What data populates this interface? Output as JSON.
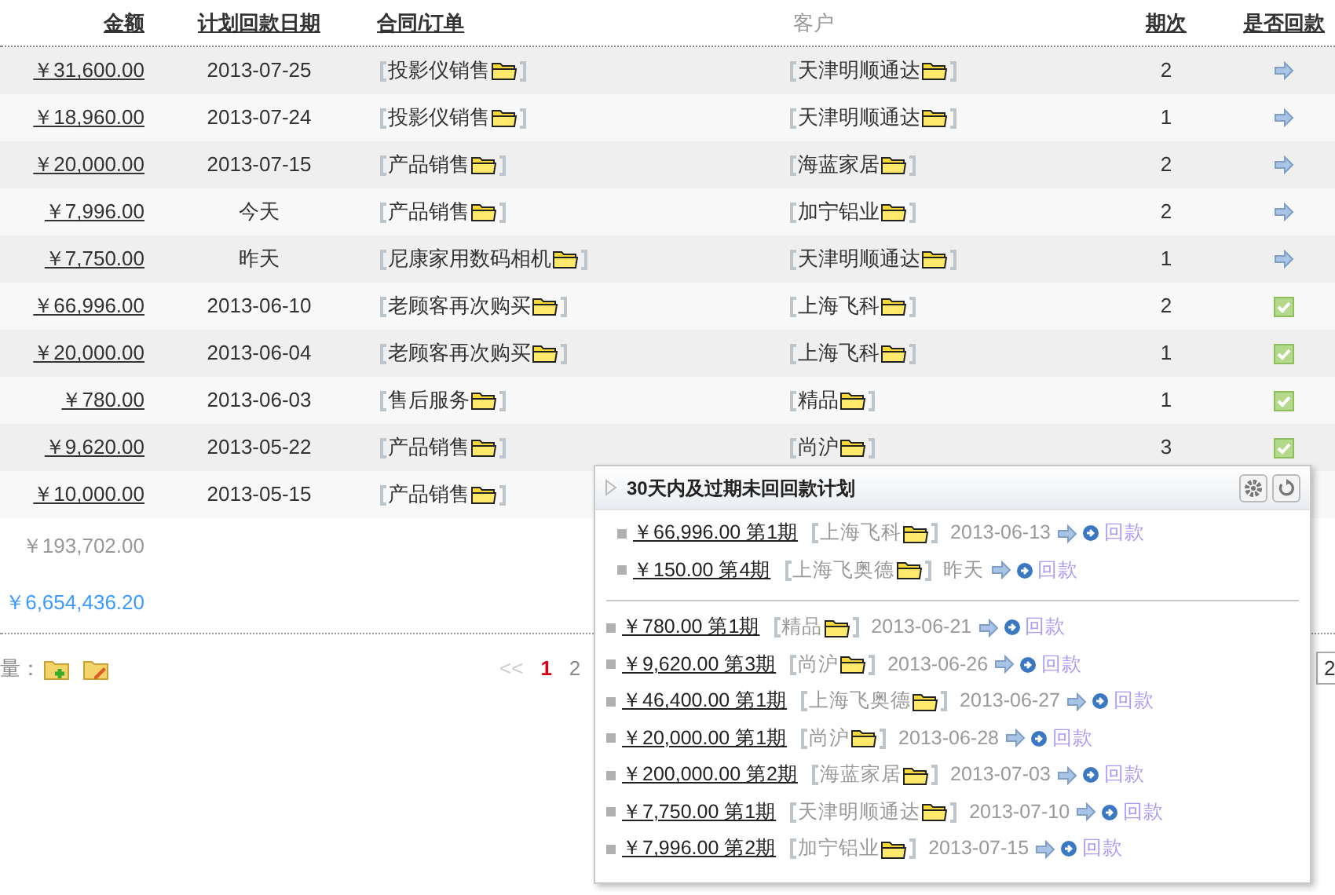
{
  "table": {
    "columns": [
      {
        "label": "金额",
        "sortable": true
      },
      {
        "label": "计划回款日期",
        "sortable": true
      },
      {
        "label": "合同/订单",
        "sortable": true
      },
      {
        "label": "客户",
        "sortable": false
      },
      {
        "label": "期次",
        "sortable": true
      },
      {
        "label": "是否回款",
        "sortable": true
      }
    ],
    "rows": [
      {
        "amount": "￥31,600.00",
        "date": "2013-07-25",
        "contract": "投影仪销售",
        "customer": "天津明顺通达",
        "period": "2",
        "paid": false
      },
      {
        "amount": "￥18,960.00",
        "date": "2013-07-24",
        "contract": "投影仪销售",
        "customer": "天津明顺通达",
        "period": "1",
        "paid": false
      },
      {
        "amount": "￥20,000.00",
        "date": "2013-07-15",
        "contract": "产品销售",
        "customer": "海蓝家居",
        "period": "2",
        "paid": false
      },
      {
        "amount": "￥7,996.00",
        "date": "今天",
        "contract": "产品销售",
        "customer": "加宁铝业",
        "period": "2",
        "paid": false
      },
      {
        "amount": "￥7,750.00",
        "date": "昨天",
        "contract": "尼康家用数码相机",
        "customer": "天津明顺通达",
        "period": "1",
        "paid": false
      },
      {
        "amount": "￥66,996.00",
        "date": "2013-06-10",
        "contract": "老顾客再次购买",
        "customer": "上海飞科",
        "period": "2",
        "paid": true
      },
      {
        "amount": "￥20,000.00",
        "date": "2013-06-04",
        "contract": "老顾客再次购买",
        "customer": "上海飞科",
        "period": "1",
        "paid": true
      },
      {
        "amount": "￥780.00",
        "date": "2013-06-03",
        "contract": "售后服务",
        "customer": "精品",
        "period": "1",
        "paid": true
      },
      {
        "amount": "￥9,620.00",
        "date": "2013-05-22",
        "contract": "产品销售",
        "customer": "尚沪",
        "period": "3",
        "paid": true
      },
      {
        "amount": "￥10,000.00",
        "date": "2013-05-15",
        "contract": "产品销售"
      }
    ],
    "subtotal": "￥193,702.00",
    "total": "￥6,654,436.20"
  },
  "footer": {
    "label": "量：",
    "pagination": {
      "prev": "<<",
      "pages": [
        {
          "label": "1",
          "selected": true
        },
        {
          "label": "2",
          "selected": false
        }
      ]
    },
    "page_input": "2"
  },
  "popup": {
    "title": "30天内及过期未回回款计划",
    "groups": [
      [
        {
          "amount": "￥66,996.00 第1期",
          "customer": "上海飞科",
          "date": "2013-06-13",
          "action": "回款"
        },
        {
          "amount": "￥150.00 第4期",
          "customer": "上海飞奥德",
          "date": "昨天",
          "action": "回款"
        }
      ],
      [
        {
          "amount": "￥780.00 第1期",
          "customer": "精品",
          "date": "2013-06-21",
          "action": "回款"
        },
        {
          "amount": "￥9,620.00 第3期",
          "customer": "尚沪",
          "date": "2013-06-26",
          "action": "回款"
        },
        {
          "amount": "￥46,400.00 第1期",
          "customer": "上海飞奥德",
          "date": "2013-06-27",
          "action": "回款"
        },
        {
          "amount": "￥20,000.00 第1期",
          "customer": "尚沪",
          "date": "2013-06-28",
          "action": "回款"
        },
        {
          "amount": "￥200,000.00 第2期",
          "customer": "海蓝家居",
          "date": "2013-07-03",
          "action": "回款"
        },
        {
          "amount": "￥7,750.00 第1期",
          "customer": "天津明顺通达",
          "date": "2013-07-10",
          "action": "回款"
        },
        {
          "amount": "￥7,996.00 第2期",
          "customer": "加宁铝业",
          "date": "2013-07-15",
          "action": "回款"
        }
      ]
    ]
  }
}
